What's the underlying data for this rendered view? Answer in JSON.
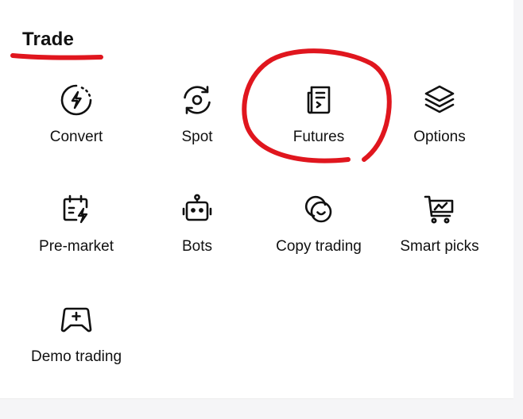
{
  "section": {
    "title": "Trade"
  },
  "items": [
    {
      "label": "Convert",
      "icon": "convert-icon"
    },
    {
      "label": "Spot",
      "icon": "spot-icon"
    },
    {
      "label": "Futures",
      "icon": "futures-icon"
    },
    {
      "label": "Options",
      "icon": "options-layers-icon"
    },
    {
      "label": "Pre-market",
      "icon": "pre-market-icon"
    },
    {
      "label": "Bots",
      "icon": "robot-icon"
    },
    {
      "label": "Copy trading",
      "icon": "copy-trading-icon"
    },
    {
      "label": "Smart picks",
      "icon": "smart-picks-cart-icon"
    },
    {
      "label": "Demo trading",
      "icon": "demo-trading-gamepad-icon"
    }
  ],
  "colors": {
    "text": "#111111",
    "annotation": "#e0161e",
    "gutter": "#f5f5f7"
  }
}
